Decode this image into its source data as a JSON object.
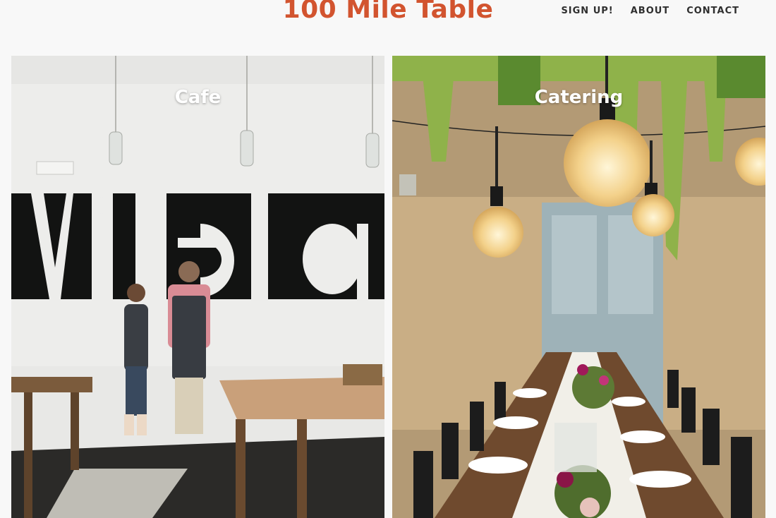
{
  "site": {
    "title": "100 Mile Table"
  },
  "nav": {
    "items": [
      "SIGN UP!",
      "ABOUT",
      "CONTACT"
    ]
  },
  "tiles": [
    {
      "label": "Cafe",
      "wall_text": "Mile Ta"
    },
    {
      "label": "Catering"
    }
  ],
  "colors": {
    "brand": "#d2542f",
    "nav_text": "#2f2f2f",
    "background": "#f8f8f8"
  }
}
